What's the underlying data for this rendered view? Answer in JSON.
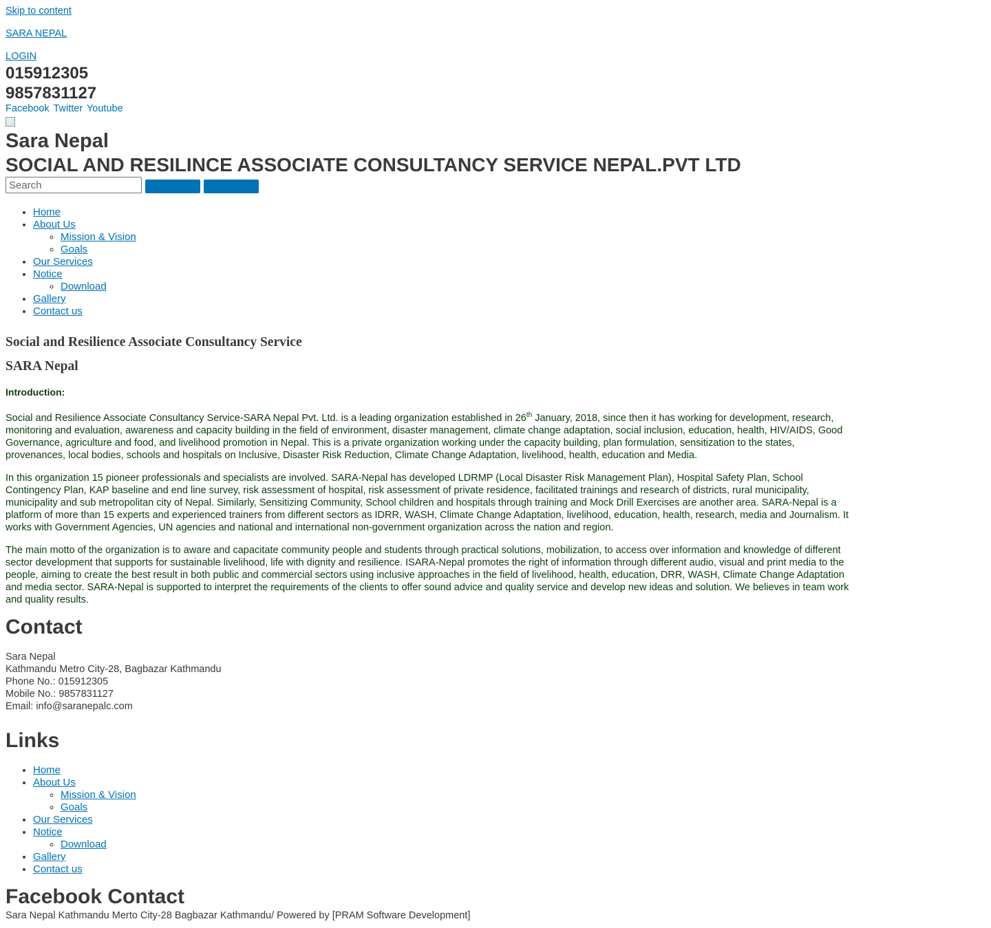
{
  "skip_link": "Skip to content",
  "brand_link": "SARA NEPAL",
  "login_link": "LOGIN",
  "phones": [
    "015912305",
    "9857831127"
  ],
  "social": [
    "Facebook",
    "Twitter",
    "Youtube"
  ],
  "site_title": "Sara Nepal",
  "site_description": "SOCIAL AND RESILINCE ASSOCIATE CONSULTANCY SERVICE NEPAL.PVT LTD",
  "search": {
    "placeholder": "Search"
  },
  "nav": {
    "home": "Home",
    "about": "About Us",
    "mission": "Mission & Vision",
    "goals": "Goals",
    "services": "Our Services",
    "notice": "Notice",
    "download": "Download",
    "gallery": "Gallery",
    "contact": "Contact us"
  },
  "main": {
    "heading1": "Social and Resilience Associate Consultancy Service",
    "heading2": "SARA Nepal",
    "intro_label": "Introduction:",
    "p1_before_sup": "Social and Resilience Associate Consultancy Service-SARA Nepal Pvt. Ltd. is a leading organization established in 26",
    "p1_sup": "th",
    "p1_after_sup": " January, 2018, since then it has working for development, research, monitoring and evaluation, awareness and capacity building in the field of environment, disaster management, climate change adaptation, social inclusion,  education, health, HIV/AIDS, Good Governance, agriculture and food, and livelihood promotion in Nepal. This is a private organization working under the capacity building, plan formulation, sensitization to the states, provenances, local bodies, schools and hospitals on Inclusive, Disaster Risk Reduction, Climate Change Adaptation, livelihood, health, education and Media.",
    "p2": "In this organization 15 pioneer professionals and specialists are involved. SARA-Nepal has developed LDRMP (Local Disaster Risk Management Plan), Hospital Safety Plan, School Contingency Plan, KAP baseline and end line survey, risk assessment of hospital, risk assessment of private residence, facilitated trainings and research of districts, rural municipality, municipality and sub metropolitan city of Nepal. Similarly, Sensitizing Community, School children and hospitals through training and Mock Drill Exercises are another area. SARA-Nepal is a platform of more than 15 experts and experienced trainers from different sectors as IDRR, WASH, Climate Change Adaptation, livelihood, education, health, research, media and Journalism. It works with Government Agencies, UN agencies and national and international non-government organization across the nation and region.",
    "p3": "The main motto of the organization is to aware and capacitate community people and students through practical solutions, mobilization, to access over information and knowledge of different sector development that supports for sustainable livelihood, life with dignity and resilience. ISARA-Nepal promotes the right of information through different audio, visual and print media to the people, aiming to create the best result in both public and commercial sectors using inclusive approaches in the field of livelihood, health, education, DRR, WASH, Climate Change Adaptation and media sector. SARA-Nepal is supported to interpret the requirements of the clients to offer sound advice and quality service and develop new ideas and solution. We believes in team work and quality results."
  },
  "contact_widget": {
    "title": "Contact",
    "lines": [
      "Sara Nepal",
      "Kathmandu Metro City-28, Bagbazar Kathmandu",
      "Phone No.: 015912305",
      "Mobile No.: 9857831127",
      "Email: info@saranepalc.com"
    ]
  },
  "links_widget": {
    "title": "Links"
  },
  "facebook_widget": {
    "title": "Facebook Contact"
  },
  "footer_text": "Sara Nepal Kathmandu Merto City-28 Bagbazar Kathmandu/ Powered by [PRAM Software Development]",
  "colors": {
    "link": "#0072b5",
    "body_text_green": "#0a3d0a",
    "heading": "#3a3a3a"
  }
}
